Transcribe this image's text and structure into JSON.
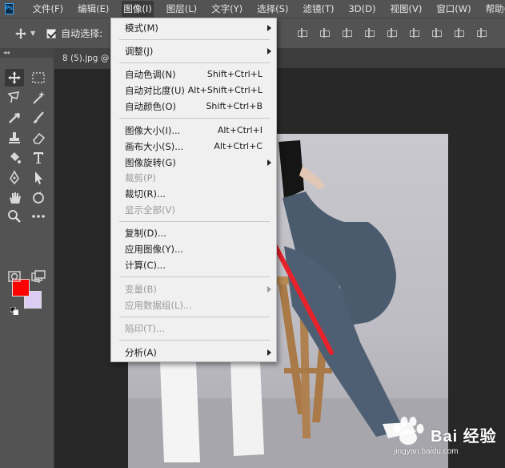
{
  "app": {
    "logo_text": "Ps"
  },
  "menubar": {
    "items": [
      {
        "label": "文件(F)"
      },
      {
        "label": "编辑(E)"
      },
      {
        "label": "图像(I)"
      },
      {
        "label": "图层(L)"
      },
      {
        "label": "文字(Y)"
      },
      {
        "label": "选择(S)"
      },
      {
        "label": "滤镜(T)"
      },
      {
        "label": "3D(D)"
      },
      {
        "label": "视图(V)"
      },
      {
        "label": "窗口(W)"
      },
      {
        "label": "帮助(H)"
      }
    ]
  },
  "options": {
    "auto_select_label": "自动选择:",
    "auto_select_checked": true
  },
  "tab": {
    "label": "8 (5).jpg @"
  },
  "toolbar": {
    "header": "◂◂",
    "fg_color": "#ff0000",
    "bg_color": "#dccbf2"
  },
  "image_menu": {
    "items": [
      {
        "label": "模式(M)",
        "shortcut": "",
        "submenu": true,
        "disabled": false
      },
      {
        "label": "调整(J)",
        "shortcut": "",
        "submenu": true,
        "disabled": false
      },
      {
        "label": "自动色调(N)",
        "shortcut": "Shift+Ctrl+L",
        "submenu": false,
        "disabled": false
      },
      {
        "label": "自动对比度(U)",
        "shortcut": "Alt+Shift+Ctrl+L",
        "submenu": false,
        "disabled": false
      },
      {
        "label": "自动颜色(O)",
        "shortcut": "Shift+Ctrl+B",
        "submenu": false,
        "disabled": false
      },
      {
        "label": "图像大小(I)...",
        "shortcut": "Alt+Ctrl+I",
        "submenu": false,
        "disabled": false
      },
      {
        "label": "画布大小(S)...",
        "shortcut": "Alt+Ctrl+C",
        "submenu": false,
        "disabled": false
      },
      {
        "label": "图像旋转(G)",
        "shortcut": "",
        "submenu": true,
        "disabled": false
      },
      {
        "label": "裁剪(P)",
        "shortcut": "",
        "submenu": false,
        "disabled": true
      },
      {
        "label": "裁切(R)...",
        "shortcut": "",
        "submenu": false,
        "disabled": false
      },
      {
        "label": "显示全部(V)",
        "shortcut": "",
        "submenu": false,
        "disabled": true
      },
      {
        "label": "复制(D)...",
        "shortcut": "",
        "submenu": false,
        "disabled": false
      },
      {
        "label": "应用图像(Y)...",
        "shortcut": "",
        "submenu": false,
        "disabled": false
      },
      {
        "label": "计算(C)...",
        "shortcut": "",
        "submenu": false,
        "disabled": false
      },
      {
        "label": "变量(B)",
        "shortcut": "",
        "submenu": true,
        "disabled": true
      },
      {
        "label": "应用数据组(L)...",
        "shortcut": "",
        "submenu": false,
        "disabled": true
      },
      {
        "label": "陷印(T)...",
        "shortcut": "",
        "submenu": false,
        "disabled": true
      },
      {
        "label": "分析(A)",
        "shortcut": "",
        "submenu": true,
        "disabled": false
      }
    ]
  },
  "watermark": {
    "text": "Bai 经验",
    "sub": "jingyan.baidu.com"
  },
  "annotation": {
    "arrow_color": "#e8222a"
  }
}
